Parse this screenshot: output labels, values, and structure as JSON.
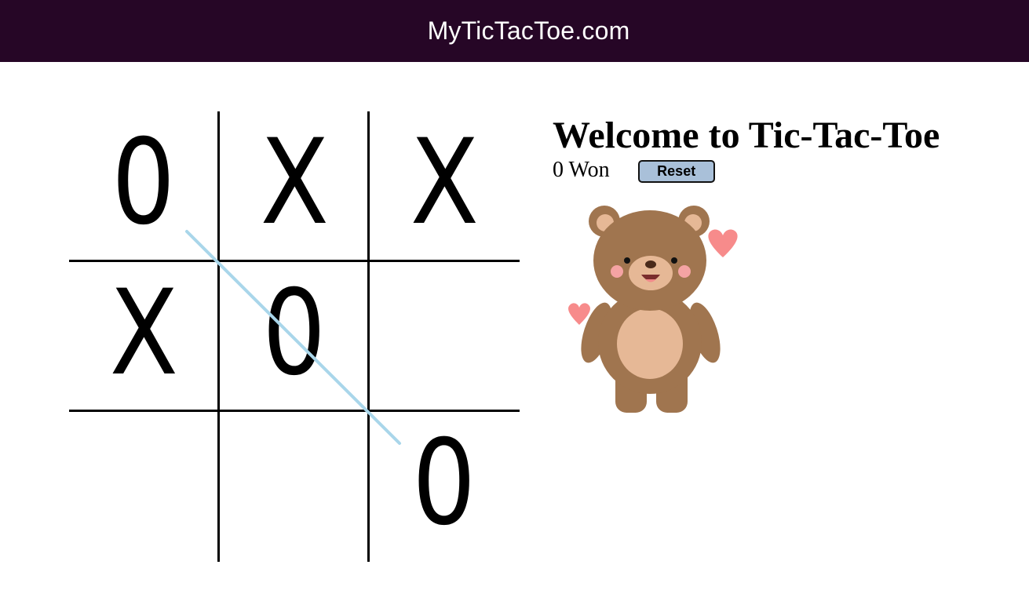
{
  "header": {
    "site_title": "MyTicTacToe.com"
  },
  "board": {
    "cells": [
      "0",
      "X",
      "X",
      "X",
      "0",
      "",
      "",
      "",
      "0"
    ],
    "winning_line": [
      0,
      4,
      8
    ],
    "win_line_color": "#a9d6ea"
  },
  "panel": {
    "title": "Welcome to Tic-Tac-Toe",
    "score_text": "0 Won",
    "reset_label": "Reset"
  },
  "colors": {
    "header_bg": "#260626",
    "button_bg": "#a9c0d9",
    "bear_fur": "#a0754f",
    "bear_belly": "#e6b896",
    "hearts": "#f78b8b"
  },
  "mascot": {
    "icon": "teddy-bear-with-hearts-icon"
  }
}
